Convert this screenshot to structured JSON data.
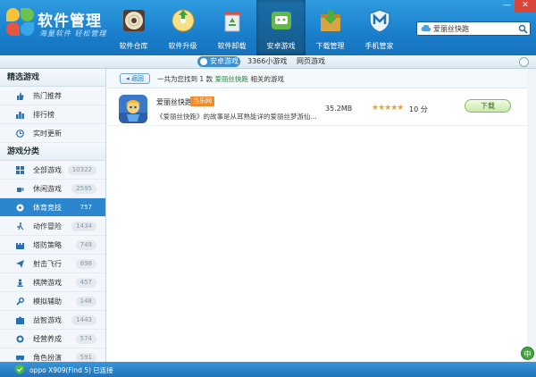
{
  "app": {
    "title": "软件管理",
    "slogan": "海量软件 轻松管理"
  },
  "nav": [
    {
      "label": "软件仓库",
      "icon": "disc-icon"
    },
    {
      "label": "软件升级",
      "icon": "upgrade-disc-icon"
    },
    {
      "label": "软件卸载",
      "icon": "recycle-bin-icon"
    },
    {
      "label": "安卓游戏",
      "icon": "android-game-icon"
    },
    {
      "label": "下载管理",
      "icon": "download-box-icon"
    },
    {
      "label": "手机管家",
      "icon": "shield-icon"
    }
  ],
  "window": {
    "minimize": "—",
    "close": "✕"
  },
  "search": {
    "value": "爱丽丝快跑"
  },
  "subtabs": [
    "安卓游戏",
    "3366小游戏",
    "网页游戏"
  ],
  "sidebar": {
    "featured_title": "精选游戏",
    "featured": [
      {
        "label": "热门推荐",
        "icon": "thumbs-up-icon"
      },
      {
        "label": "排行榜",
        "icon": "ranking-icon"
      },
      {
        "label": "实时更新",
        "icon": "clock-icon"
      }
    ],
    "categories_title": "游戏分类",
    "categories": [
      {
        "label": "全部游戏",
        "count": "10322",
        "icon": "grid-icon"
      },
      {
        "label": "休闲游戏",
        "count": "2595",
        "icon": "coffee-icon"
      },
      {
        "label": "体育竞技",
        "count": "757",
        "icon": "ball-icon",
        "active": true
      },
      {
        "label": "动作冒险",
        "count": "1434",
        "icon": "running-icon"
      },
      {
        "label": "塔防策略",
        "count": "749",
        "icon": "castle-icon"
      },
      {
        "label": "射击飞行",
        "count": "898",
        "icon": "plane-icon"
      },
      {
        "label": "棋牌游戏",
        "count": "457",
        "icon": "chess-icon"
      },
      {
        "label": "模拟辅助",
        "count": "148",
        "icon": "wrench-icon"
      },
      {
        "label": "益智游戏",
        "count": "1443",
        "icon": "puzzle-icon"
      },
      {
        "label": "经营养成",
        "count": "574",
        "icon": "coins-icon"
      },
      {
        "label": "角色扮演",
        "count": "591",
        "icon": "mask-icon"
      }
    ]
  },
  "results": {
    "back_label": "返回",
    "text_prefix": "一共为您找到 1 款",
    "keyword": "爱丽丝快跑",
    "text_suffix": "相关的游戏",
    "apps": [
      {
        "name": "爱丽丝快跑",
        "tag": "当乐网",
        "desc": "《爱丽丝快跑》的故事是从耳熟能详的爱丽丝梦游仙...",
        "size": "35.2MB",
        "stars": "★★★★★",
        "score": "10 分",
        "download_label": "下载"
      }
    ]
  },
  "ime": "中",
  "status": {
    "text": "oppo X909(Find 5) 已连接"
  },
  "colors": {
    "header": "#1a7fcc",
    "active": "#2c86cd",
    "accent_green": "#1f8a3a",
    "tag": "#f18a2b"
  }
}
